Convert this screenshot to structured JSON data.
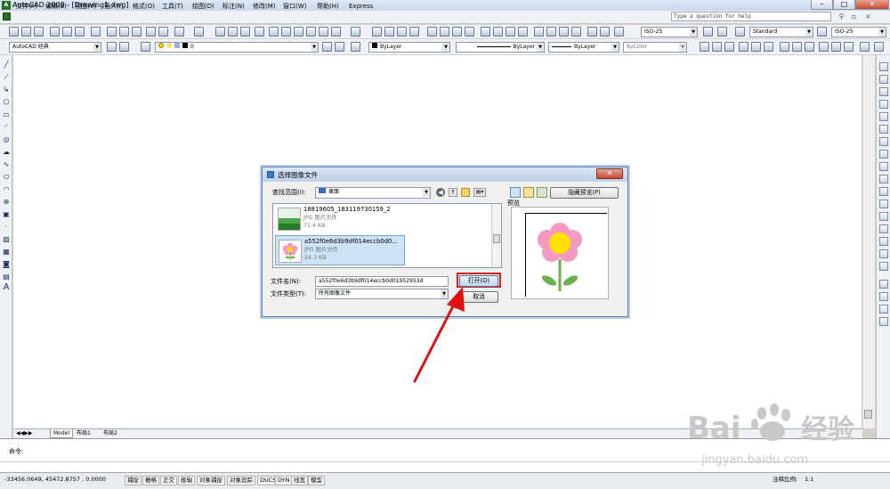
{
  "app": {
    "icon_text": "A",
    "title": "AutoCAD 2008 - [Drawing1.dwg]",
    "question_placeholder": "Type a question for help",
    "window_controls": [
      "–",
      "□",
      "✕"
    ]
  },
  "menu": [
    "文件(F)",
    "编辑(E)",
    "视图(V)",
    "插入(I)",
    "格式(O)",
    "工具(T)",
    "绘图(D)",
    "标注(N)",
    "修改(M)",
    "窗口(W)",
    "帮助(H)",
    "Express"
  ],
  "toolbar": {
    "workspace": "AutoCAD 经典",
    "layer": "0",
    "color": "ByLayer",
    "linetype": "ByLayer",
    "lineweight": "ByLayer",
    "plotstyle": "ByColor",
    "dimstyle": "ISO-25",
    "textstyle": "Standard",
    "dimstyle2": "ISO-25"
  },
  "tabs": [
    "Model",
    "布局1",
    "布局2"
  ],
  "command": {
    "label": "命令:"
  },
  "status": {
    "coords": "-33456.0649, 45472.8757 , 0.0000",
    "toggles": [
      "捕捉",
      "栅格",
      "正交",
      "极轴",
      "对象捕捉",
      "对象追踪",
      "DUCS",
      "DYN",
      "线宽",
      "模型"
    ],
    "annotation_scale_label": "注释比例:",
    "annotation_scale_value": "1:1"
  },
  "dialog": {
    "title": "选择图像文件",
    "lookin_label": "查找范围(I):",
    "lookin_value": "桌面",
    "hide_preview": "隐藏预览(P)",
    "preview_label": "预览",
    "files": [
      {
        "name": "18819605_183119730159_2",
        "type": "JPG 图片文件",
        "size": "71.4 KB"
      },
      {
        "name": "a552f0e6d3b9df014eccb0d0...",
        "type": "JPG 图片文件",
        "size": "24.3 KB"
      }
    ],
    "filename_label": "文件名(N):",
    "filename_value": "a552f0e6d3b9df014eccb0d01952953d",
    "filetype_label": "文件类型(T):",
    "filetype_value": "所有图像文件",
    "open_button": "打开(O)",
    "cancel_button": "取消"
  },
  "watermark": {
    "brand": "Bai",
    "brand2": "du",
    "cn": "经验",
    "url": "jingyan.baidu.com"
  }
}
